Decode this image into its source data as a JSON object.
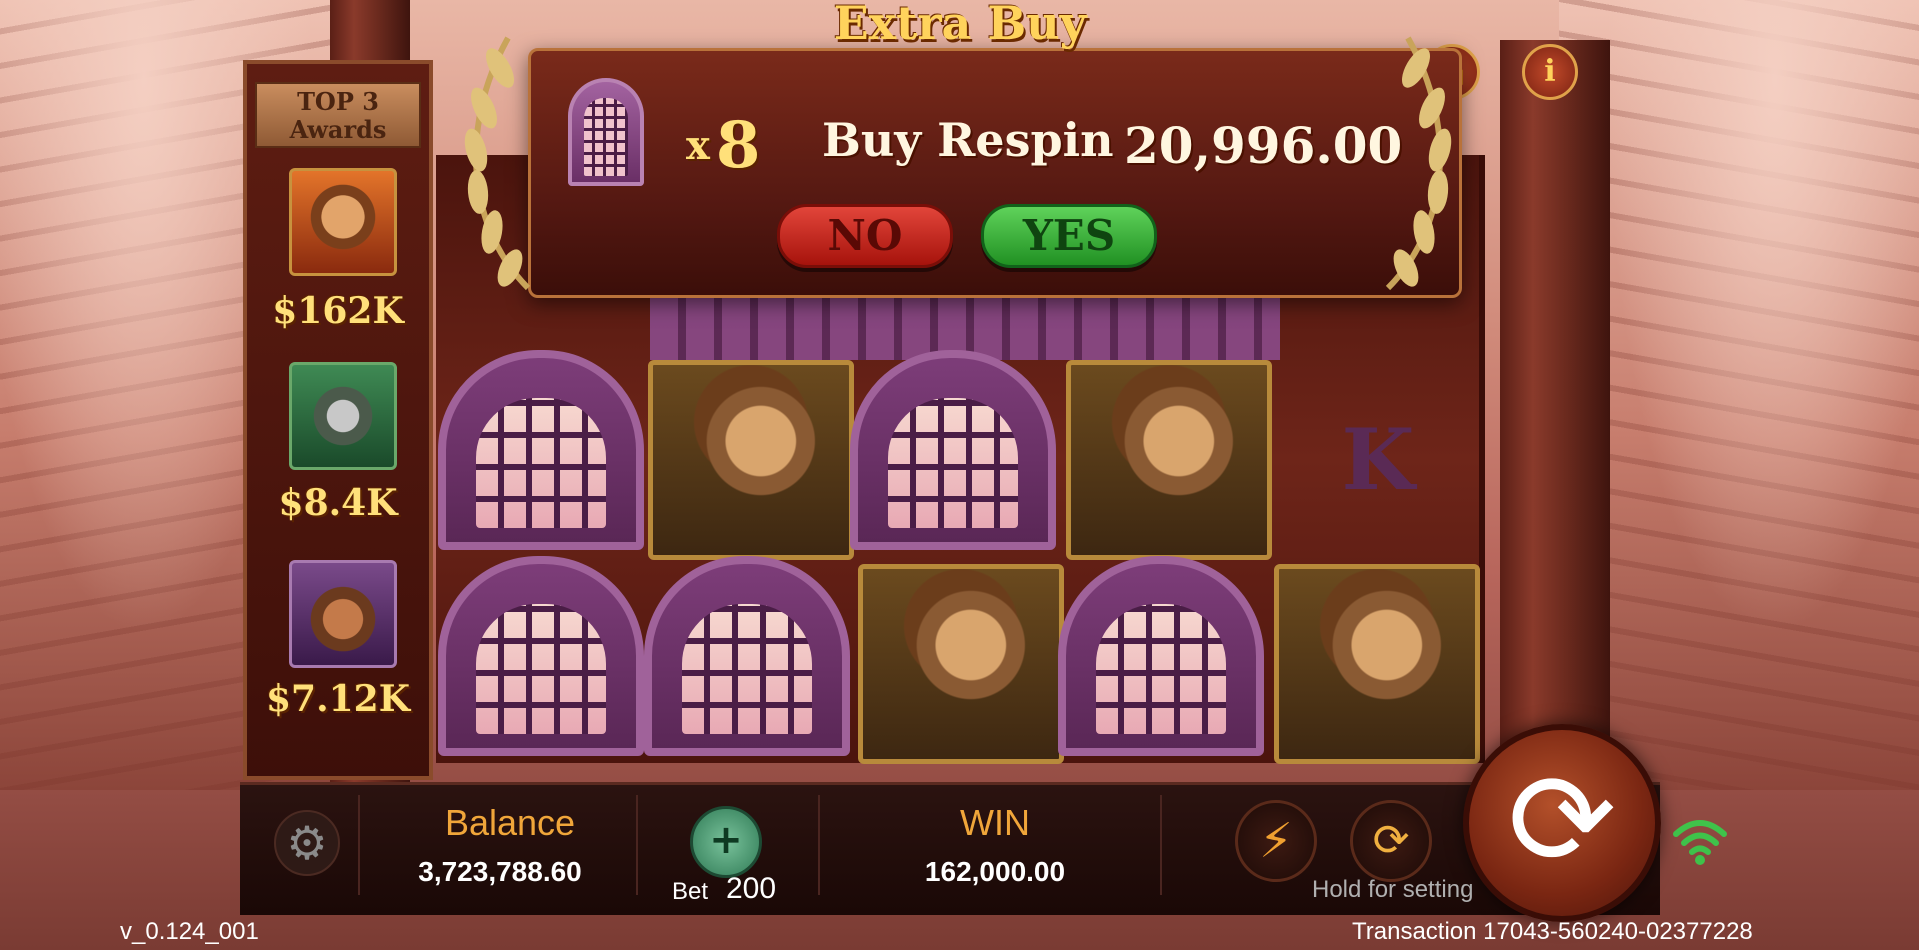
{
  "dialog": {
    "title": "Extra Buy",
    "multiplier_prefix": "x",
    "multiplier": "8",
    "buy_label": "Buy Respin",
    "price": "20,996.00",
    "no_label": "NO",
    "yes_label": "YES"
  },
  "top_icons": {
    "info_glyph": "i",
    "lock_icon": "lock-icon"
  },
  "awards": {
    "title_line1": "TOP 3",
    "title_line2": "Awards",
    "items": [
      {
        "icon": "gladiator-portrait-icon",
        "value": "$162K"
      },
      {
        "icon": "gladiator-helmet-icon",
        "value": "$8.4K"
      },
      {
        "icon": "bear-icon",
        "value": "$7.12K"
      }
    ]
  },
  "reels": {
    "rows": [
      [
        "gate",
        "hero",
        "gate",
        "hero",
        "K"
      ],
      [
        "gate",
        "gate",
        "hero",
        "gate",
        "hero"
      ]
    ],
    "k_symbol": "K"
  },
  "bottom": {
    "balance_label": "Balance",
    "balance_value": "3,723,788.60",
    "bet_label": "Bet",
    "bet_value": "200",
    "win_label": "WIN",
    "win_value": "162,000.00",
    "hold_label": "Hold for setting"
  },
  "footer": {
    "version": "v_0.124_001",
    "transaction": "Transaction 17043-560240-02377228"
  },
  "colors": {
    "gold": "#ffe07a",
    "no_red": "#c42a20",
    "yes_green": "#3fb43e",
    "label_orange": "#f0a63a"
  }
}
